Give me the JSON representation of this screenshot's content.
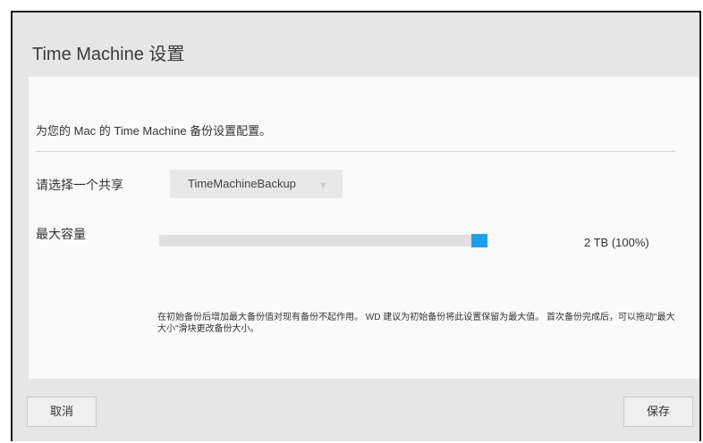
{
  "dialog": {
    "title": "Time Machine 设置"
  },
  "panel": {
    "description": "为您的 Mac 的 Time Machine 备份设置配置。",
    "share_label": "请选择一个共享",
    "share_selected": "TimeMachineBackup",
    "capacity_label": "最大容量",
    "capacity_fraction": 1.0,
    "capacity_value": "2 TB (100%)",
    "note": "在初始备份后增加最大备份值对现有备份不起作用。 WD 建议为初始备份将此设置保留为最大值。 首次备份完成后，可以拖动\"最大大小\"滑块更改备份大小。"
  },
  "buttons": {
    "cancel": "取消",
    "save": "保存"
  },
  "colors": {
    "accent": "#1e9fe8",
    "background": "#e6e6e6",
    "panel": "#fafafa"
  },
  "icons": {
    "dropdown": "chevron-down-icon"
  }
}
